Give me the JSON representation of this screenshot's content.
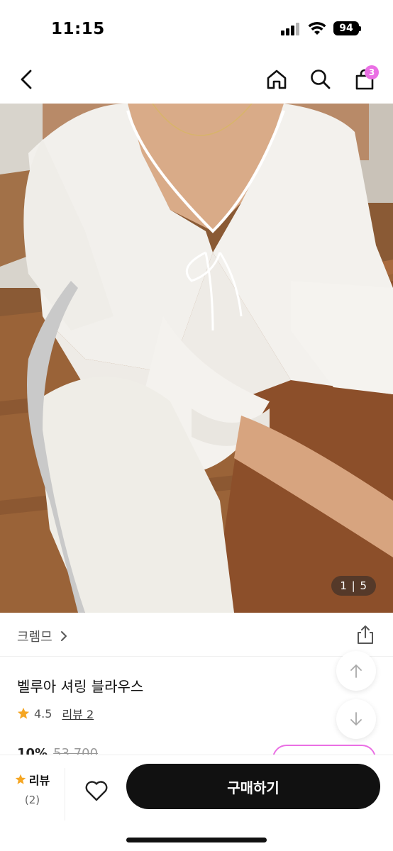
{
  "status_bar": {
    "time": "11:15",
    "battery": "94"
  },
  "nav": {
    "cart_count": "3"
  },
  "hero": {
    "counter": "1 | 5"
  },
  "product": {
    "brand": "크렘므",
    "name": "벨루아 셔링 블라우스",
    "rating": "4.5",
    "review_link": "리뷰 2",
    "discount": "10%",
    "original_price": "53,700"
  },
  "bottom_bar": {
    "review_label": "리뷰",
    "review_count": "(2)",
    "buy_label": "구매하기"
  },
  "colors": {
    "accent": "#ea6fe4",
    "star": "#f5a623",
    "buy_button": "#111111"
  }
}
